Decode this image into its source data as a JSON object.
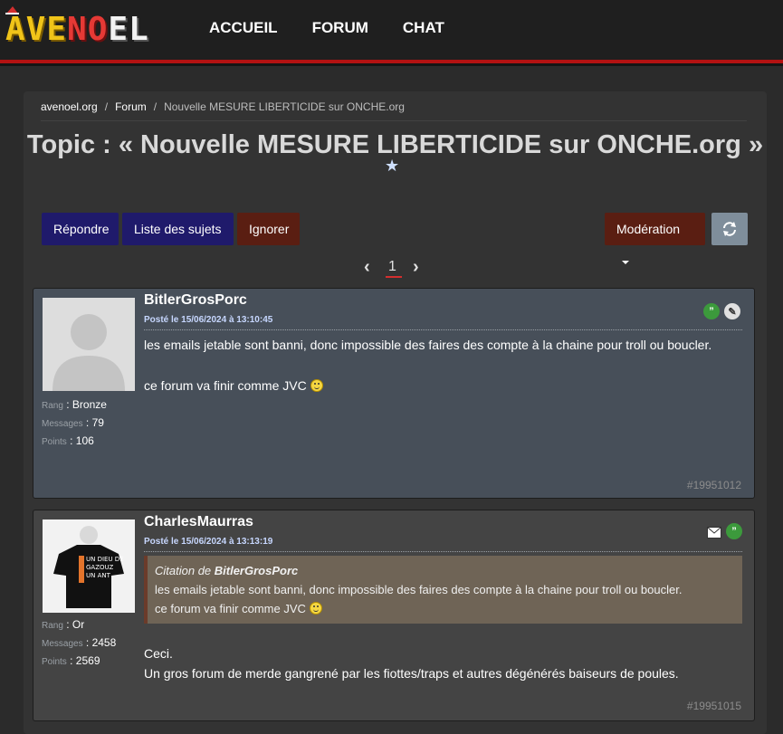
{
  "nav": {
    "logo_parts": [
      "AVE",
      "NO",
      "EL"
    ],
    "items": [
      "ACCUEIL",
      "FORUM",
      "CHAT"
    ]
  },
  "breadcrumb": [
    "avenoel.org",
    "Forum",
    "Nouvelle MESURE LIBERTICIDE sur ONCHE.org"
  ],
  "topic": {
    "title": "Topic : « Nouvelle MESURE LIBERTICIDE sur ONCHE.org »",
    "star": "★"
  },
  "buttons": {
    "reply": "Répondre",
    "subjects": "Liste des sujets",
    "ignore": "Ignorer",
    "moderation": "Modération",
    "refresh_icon": "refresh-icon"
  },
  "pager": {
    "prev": "‹",
    "current": "1",
    "next": "›"
  },
  "posts": [
    {
      "author": "BitlerGrosPorc",
      "date": "Posté le 15/06/2024 à 13:10:45",
      "stats": [
        {
          "k": "Rang",
          "v": " : Bronze"
        },
        {
          "k": "Messages",
          "v": " : 79"
        },
        {
          "k": "Points",
          "v": " : 106"
        }
      ],
      "lines": [
        "les emails jetable sont banni, donc impossible des faires des compte à la chaine pour troll ou boucler.",
        "ce forum va finir comme JVC"
      ],
      "id": "#19951012"
    },
    {
      "author": "CharlesMaurras",
      "date": "Posté le 15/06/2024 à 13:13:19",
      "stats": [
        {
          "k": "Rang",
          "v": " : Or"
        },
        {
          "k": "Messages",
          "v": " : 2458"
        },
        {
          "k": "Points",
          "v": " : 2569"
        }
      ],
      "quote": {
        "prefix": "Citation de ",
        "author": "BitlerGrosPorc",
        "line1": "les emails jetable sont banni, donc impossible des faires des compte à la chaine pour troll ou boucler.",
        "line2": "ce forum va finir comme JVC"
      },
      "lines": [
        "Ceci.",
        "Un gros forum de merde gangrené par les fiottes/traps et autres dégénérés baiseurs de poules."
      ],
      "id": "#19951015"
    }
  ],
  "colors": {
    "accent_red": "#b31212",
    "button_blue": "#1f1a6b",
    "button_brown": "#5a1e12"
  }
}
